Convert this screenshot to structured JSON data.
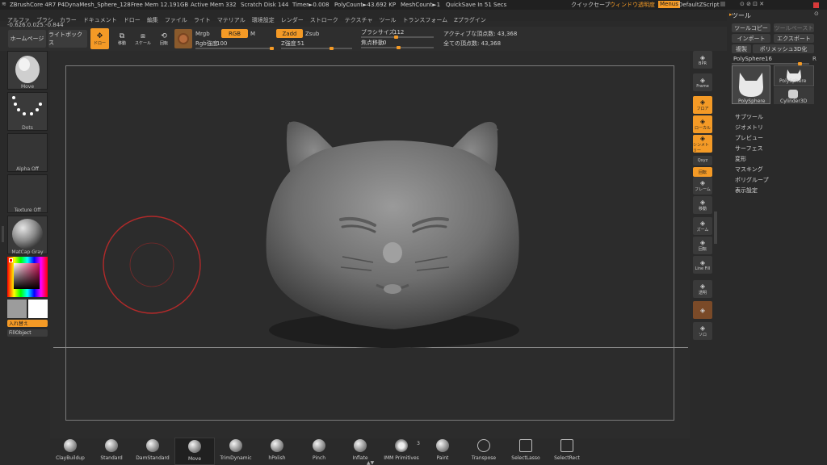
{
  "titlebar": {
    "app": "ZBrushCore 4R7 P4",
    "document": "DynaMesh_Sphere_128",
    "free_mem": "Free Mem 12.191GB",
    "active_mem": "Active Mem 332",
    "scratch_disk": "Scratch Disk 144",
    "timer": "Timer►0.008",
    "polycount": "PolyCount►43.692 KP",
    "meshcount": "MeshCount►1",
    "quicksave": "QuickSave In 51 Secs",
    "quick_save_btn": "クイックセーブ",
    "window_transparency": "ウィンドウ透明度",
    "menus": "Menus",
    "default_script": "DefaultZScript"
  },
  "menubar": [
    "アルファ",
    "ブラシ",
    "カラー",
    "ドキュメント",
    "ドロー",
    "編集",
    "ファイル",
    "ライト",
    "マテリアル",
    "環境設定",
    "レンダー",
    "ストローク",
    "テクスチャ",
    "ツール",
    "トランスフォーム",
    "Zプラグイン"
  ],
  "coords": "-0.626,0.025,-0.844",
  "toprow": {
    "home": "ホームページ",
    "lightbox": "ライトボックス",
    "draw": "ドロー",
    "move": "移動",
    "scale": "スケール",
    "rotate": "回転",
    "mrgb": "Mrgb",
    "rgb": "RGB",
    "m": "M",
    "zadd": "Zadd",
    "zsub": "Zsub",
    "rgb_intensity_label": "Rgb強度",
    "rgb_intensity": "100",
    "z_intensity_label": "Z強度",
    "z_intensity": "51",
    "brush_size_label": "ブラシサイズ",
    "brush_size": "112",
    "focal_shift_label": "焦点移動",
    "focal_shift": "0",
    "active_points": "アクティブな頂点数: 43,368",
    "total_points": "全ての頂点数: 43,368"
  },
  "left": {
    "brush": "Move",
    "stroke": "Dots",
    "alpha": "Alpha Off",
    "texture": "Texture Off",
    "material": "MatCap Gray",
    "swap": "入れ替え",
    "fill": "FillObject"
  },
  "right_icons": [
    "BPR",
    "Frame",
    "フロア",
    "ローカル",
    "シンメトリー",
    "Qxyz",
    "回転",
    "フレーム",
    "移動",
    "ズーム",
    "回転",
    "Line Fill",
    "透明",
    "",
    "ソロ"
  ],
  "tool_panel": {
    "title": "ツール",
    "tool_copy": "ツールコピー",
    "tool_paste": "ツールペースト",
    "import": "インポート",
    "export": "エクスポート",
    "clone": "複製",
    "polymesh": "ポリメッシュ3D化",
    "polysphere_label": "PolySphere",
    "polysphere_value": "16",
    "thumb1": "PolySphere",
    "thumb2": "PolySphere",
    "thumb3": "Cylinder3D",
    "sections": [
      "サブツール",
      "ジオメトリ",
      "プレビュー",
      "サーフェス",
      "変形",
      "マスキング",
      "ポリグループ",
      "表示設定"
    ]
  },
  "bottom_brushes": [
    "ClayBuildup",
    "Standard",
    "DamStandard",
    "Move",
    "TrimDynamic",
    "hPolish",
    "Pinch",
    "Inflate",
    "IMM Primitives",
    "Paint",
    "Transpose",
    "SelectLasso",
    "SelectRect"
  ],
  "imm_count": "3"
}
